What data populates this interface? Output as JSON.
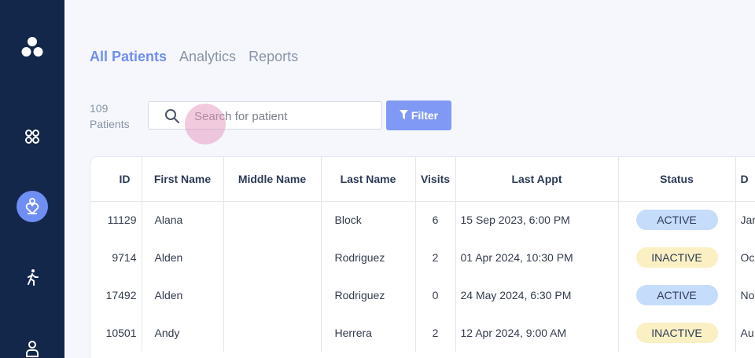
{
  "sidebar": {
    "logo_icon": "three-circles-logo-icon",
    "items": [
      {
        "icon": "grid-icon",
        "active": false
      },
      {
        "icon": "heart-person-icon",
        "active": true
      },
      {
        "icon": "walking-person-icon",
        "active": false
      },
      {
        "icon": "user-icon",
        "active": false
      }
    ]
  },
  "tabs": [
    {
      "label": "All Patients",
      "active": true
    },
    {
      "label": "Analytics",
      "active": false
    },
    {
      "label": "Reports",
      "active": false
    }
  ],
  "patient_count": {
    "number": "109",
    "label": "Patients"
  },
  "search": {
    "placeholder": "Search for patient",
    "value": ""
  },
  "filter_button": {
    "label": "Filter",
    "icon": "funnel-icon"
  },
  "table": {
    "headers": [
      "ID",
      "First Name",
      "Middle Name",
      "Last Name",
      "Visits",
      "Last Appt",
      "Status",
      "D"
    ],
    "rows": [
      {
        "id": "11129",
        "first": "Alana",
        "middle": "",
        "last": "Block",
        "visits": "6",
        "last_appt": "15 Sep 2023, 6:00 PM",
        "status": "ACTIVE",
        "extra": "Jar"
      },
      {
        "id": "9714",
        "first": "Alden",
        "middle": "",
        "last": "Rodriguez",
        "visits": "2",
        "last_appt": "01 Apr 2024, 10:30 PM",
        "status": "INACTIVE",
        "extra": "Oc"
      },
      {
        "id": "17492",
        "first": "Alden",
        "middle": "",
        "last": "Rodriguez",
        "visits": "0",
        "last_appt": "24 May 2024, 6:30 PM",
        "status": "ACTIVE",
        "extra": "No"
      },
      {
        "id": "10501",
        "first": "Andy",
        "middle": "",
        "last": "Herrera",
        "visits": "2",
        "last_appt": "12 Apr 2024, 9:00 AM",
        "status": "INACTIVE",
        "extra": "Au"
      }
    ]
  },
  "colors": {
    "sidebar_bg": "#13274b",
    "accent": "#6f8ef4",
    "active_badge": "#c6dcfb",
    "inactive_badge": "#fbf0c3"
  }
}
